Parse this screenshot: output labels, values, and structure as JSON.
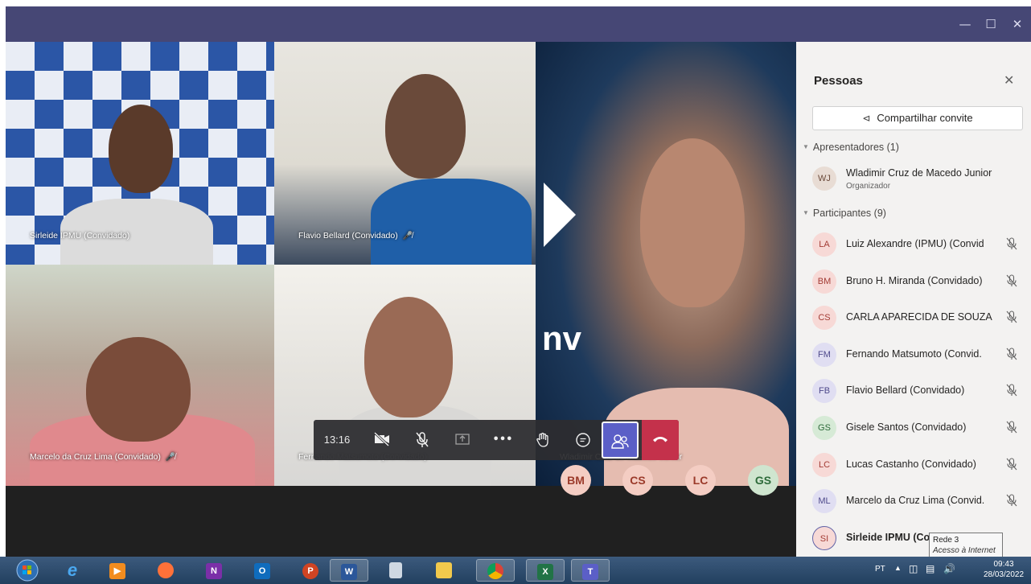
{
  "window": {
    "minimize_icon": "minimize-icon",
    "maximize_icon": "maximize-icon",
    "close_icon": "close-icon"
  },
  "tiles": {
    "sirleide": {
      "name": "Sirleide IPMU (Convidado)"
    },
    "flavio": {
      "name": "Flavio Bellard (Convidado)"
    },
    "wladimir": {
      "name": "Wladimir Cruz de Macedo Junior"
    },
    "marcelo": {
      "name": "Marcelo da Cruz Lima (Convidado)"
    },
    "fernando": {
      "name": "Fernando Matsumoto (Convidado)"
    },
    "wladimir_bg_text": "nv"
  },
  "avatars_row": [
    {
      "initials": "BM",
      "bg": "#f4cdc3",
      "fg": "#9b3a2a"
    },
    {
      "initials": "CS",
      "bg": "#f4cdc3",
      "fg": "#9b3a2a"
    },
    {
      "initials": "LC",
      "bg": "#f4cdc3",
      "fg": "#9b3a2a"
    },
    {
      "initials": "GS",
      "bg": "#cfe5cf",
      "fg": "#2d6a3a"
    }
  ],
  "controls": {
    "timer": "13:16",
    "buttons": [
      "camera-off",
      "mic-off",
      "share",
      "more",
      "raise-hand",
      "chat",
      "people",
      "hang-up"
    ],
    "more_label": "•••"
  },
  "panel": {
    "title": "Pessoas",
    "invite_label": "Compartilhar convite",
    "presenters_header": "Apresentadores (1)",
    "participants_header": "Participantes (9)",
    "presenter": {
      "initials": "WJ",
      "name": "Wladimir Cruz de Macedo Junior",
      "role": "Organizador",
      "bg": "#e8dcd4",
      "fg": "#6b4a3a"
    },
    "participants": [
      {
        "initials": "LA",
        "name": "Luiz Alexandre (IPMU) (Convid",
        "bg": "#f7d9d6",
        "fg": "#a33c35"
      },
      {
        "initials": "BM",
        "name": "Bruno H. Miranda (Convidado)",
        "bg": "#f7d9d6",
        "fg": "#a33c35"
      },
      {
        "initials": "CS",
        "name": "CARLA APARECIDA DE SOUZA",
        "bg": "#f7d9d6",
        "fg": "#a33c35"
      },
      {
        "initials": "FM",
        "name": "Fernando Matsumoto (Convid.",
        "bg": "#e0def2",
        "fg": "#4f4a8c"
      },
      {
        "initials": "FB",
        "name": "Flavio Bellard (Convidado)",
        "bg": "#e0def2",
        "fg": "#4f4a8c"
      },
      {
        "initials": "GS",
        "name": "Gisele Santos (Convidado)",
        "bg": "#d6ead6",
        "fg": "#2d6a3a"
      },
      {
        "initials": "LC",
        "name": "Lucas Castanho (Convidado)",
        "bg": "#f7d9d6",
        "fg": "#a33c35"
      },
      {
        "initials": "ML",
        "name": "Marcelo da Cruz Lima (Convid.",
        "bg": "#e0def2",
        "fg": "#4f4a8c"
      },
      {
        "initials": "SI",
        "name": "Sirleide IPMU (Co",
        "bg": "#f7d9d6",
        "fg": "#a33c35"
      }
    ]
  },
  "tooltip": {
    "line1": "Rede 3",
    "line2": "Acesso à Internet"
  },
  "taskbar": {
    "apps": [
      {
        "id": "start",
        "label": ""
      },
      {
        "id": "ie",
        "label": "e"
      },
      {
        "id": "media",
        "label": "▶"
      },
      {
        "id": "firefox",
        "label": ""
      },
      {
        "id": "onenote",
        "label": "N"
      },
      {
        "id": "outlook",
        "label": "O"
      },
      {
        "id": "powerpoint",
        "label": "P"
      },
      {
        "id": "word",
        "label": "W"
      },
      {
        "id": "calculator",
        "label": ""
      },
      {
        "id": "explorer",
        "label": ""
      },
      {
        "id": "chrome",
        "label": ""
      },
      {
        "id": "excel",
        "label": "X"
      },
      {
        "id": "teams",
        "label": "T"
      }
    ],
    "lang": "PT",
    "time": "09:43",
    "date": "28/03/2022"
  }
}
